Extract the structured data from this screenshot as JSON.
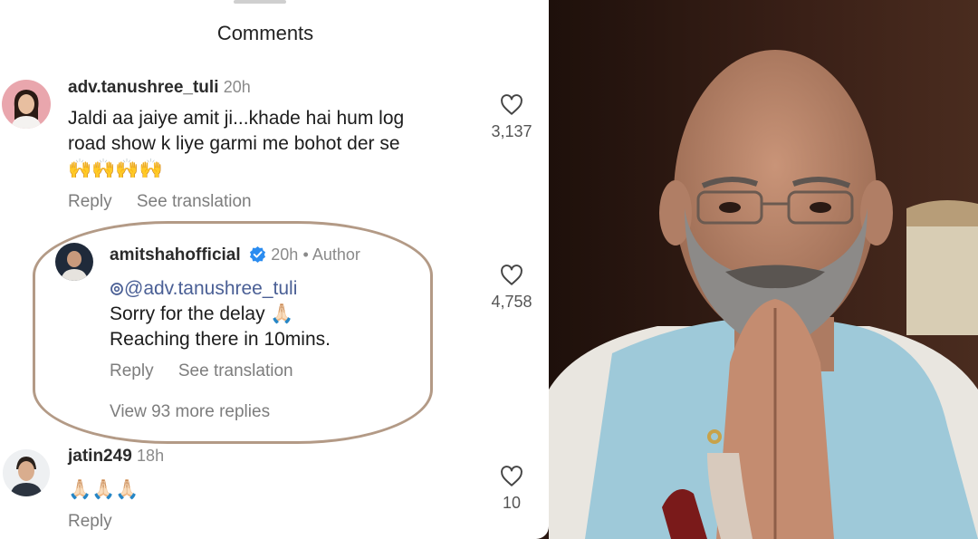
{
  "header": {
    "title": "Comments"
  },
  "comments": [
    {
      "username": "adv.tanushree_tuli",
      "time": "20h",
      "lines": [
        "Jaldi aa jaiye amit ji...khade hai hum log",
        "road show k liye garmi me bohot der se"
      ],
      "emoji": "🙌🙌🙌🙌",
      "actions": {
        "reply": "Reply",
        "translate": "See translation"
      },
      "likes": "3,137"
    },
    {
      "username": "amitshahofficial",
      "time": "20h",
      "author_label": "• Author",
      "mention": "@adv.tanushree_tuli",
      "lines": [
        "Sorry for the delay 🙏🏻",
        "Reaching there in 10mins."
      ],
      "actions": {
        "reply": "Reply",
        "translate": "See translation"
      },
      "view_more": "View 93 more replies",
      "likes": "4,758"
    },
    {
      "username": "jatin249",
      "time": "18h",
      "emoji": "🙏🏻🙏🏻🙏🏻",
      "actions": {
        "reply": "Reply"
      },
      "likes": "10"
    }
  ],
  "icons": {
    "like": "heart-outline-icon",
    "verified": "verified-badge-icon",
    "threads": "threads-logo-icon"
  },
  "colors": {
    "verified": "#2b8cf0",
    "highlight": "#b39a86",
    "muted_text": "#7d7d7d"
  }
}
